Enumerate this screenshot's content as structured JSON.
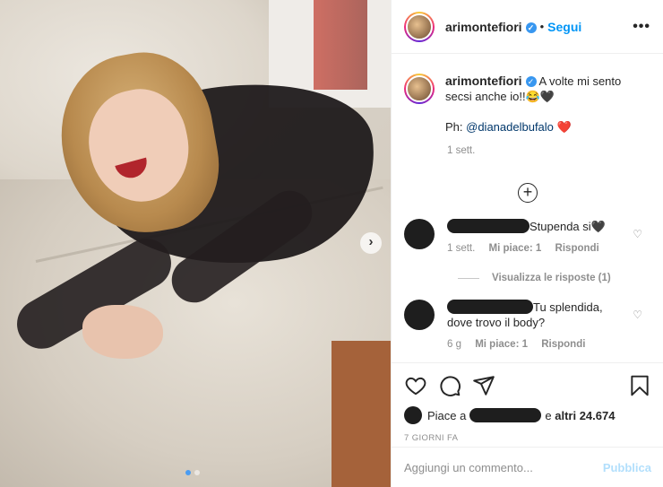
{
  "post": {
    "username": "arimontefiori",
    "follow_label": "Segui",
    "more_label": "•••",
    "separator": "•",
    "carousel_next": "›"
  },
  "caption": {
    "username": "arimontefiori",
    "text": "A volte mi sento secsi anche io!!😂🖤",
    "credit_prefix": "Ph: ",
    "credit_mention": "@dianadelbufalo",
    "credit_emoji": "❤️",
    "time": "1 sett."
  },
  "load_more": "+",
  "comments": [
    {
      "text": "Stupenda si🖤",
      "time": "1 sett.",
      "likes": "Mi piace: 1",
      "reply": "Rispondi",
      "like_icon": "heart-outline-icon"
    },
    {
      "text": "Tu splendida, dove trovo il body?",
      "time": "6 g",
      "likes": "Mi piace: 1",
      "reply": "Rispondi",
      "like_icon": "heart-outline-icon"
    }
  ],
  "view_replies": "Visualizza le risposte (1)",
  "actions": {
    "icons": [
      "heart-icon",
      "comment-icon",
      "share-icon",
      "bookmark-icon"
    ],
    "likes_prefix": "Piace a",
    "likes_suffix_connector": "e",
    "likes_others": "altri 24.674",
    "date": "7 GIORNI FA"
  },
  "comment_box": {
    "placeholder": "Aggiungi un commento...",
    "publish_label": "Pubblica"
  },
  "colors": {
    "accent": "#0095f6",
    "publish_disabled": "#b2dffc",
    "muted": "#8e8e8e"
  }
}
